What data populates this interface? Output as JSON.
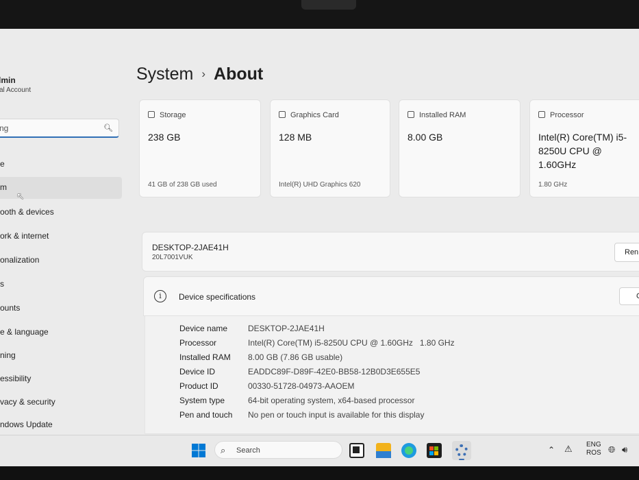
{
  "user": {
    "name": "dmin",
    "account": "cal Account"
  },
  "sidebar": {
    "search_value": "ng",
    "items": [
      {
        "label": "e"
      },
      {
        "label": "m"
      },
      {
        "label": "ooth & devices"
      },
      {
        "label": "ork & internet"
      },
      {
        "label": "onalization"
      },
      {
        "label": "s"
      },
      {
        "label": "ounts"
      },
      {
        "label": "e & language"
      },
      {
        "label": "ning"
      },
      {
        "label": "essibility"
      },
      {
        "label": "vacy & security"
      },
      {
        "label": "ndows Update"
      }
    ]
  },
  "breadcrumb": {
    "parent": "System",
    "separator": "›",
    "current": "About"
  },
  "cards": [
    {
      "title": "Storage",
      "value": "238 GB",
      "sub": "41 GB of 238 GB used"
    },
    {
      "title": "Graphics Card",
      "value": "128 MB",
      "sub": "Intel(R) UHD Graphics 620"
    },
    {
      "title": "Installed RAM",
      "value": "8.00 GB",
      "sub": ""
    },
    {
      "title": "Processor",
      "value": "Intel(R) Core(TM) i5-8250U CPU @ 1.60GHz",
      "sub": "1.80 GHz"
    }
  ],
  "device": {
    "name": "DESKTOP-2JAE41H",
    "model": "20L7001VUK",
    "rename_label": "Ren"
  },
  "specs": {
    "title": "Device specifications",
    "copy_label": "C",
    "rows": [
      {
        "key": "Device name",
        "value": "DESKTOP-2JAE41H"
      },
      {
        "key": "Processor",
        "value": "Intel(R) Core(TM) i5-8250U CPU @ 1.60GHz   1.80 GHz"
      },
      {
        "key": "Installed RAM",
        "value": "8.00 GB (7.86 GB usable)"
      },
      {
        "key": "Device ID",
        "value": "EADDC89F-D89F-42E0-BB58-12B0D3E655E5"
      },
      {
        "key": "Product ID",
        "value": "00330-51728-04973-AAOEM"
      },
      {
        "key": "System type",
        "value": "64-bit operating system, x64-based processor"
      },
      {
        "key": "Pen and touch",
        "value": "No pen or touch input is available for this display"
      }
    ]
  },
  "taskbar": {
    "search_label": "Search",
    "lang_top": "ENG",
    "lang_bottom": "ROS"
  },
  "colors": {
    "accent": "#2f6fb5",
    "windows_blue": "#0078d4"
  }
}
